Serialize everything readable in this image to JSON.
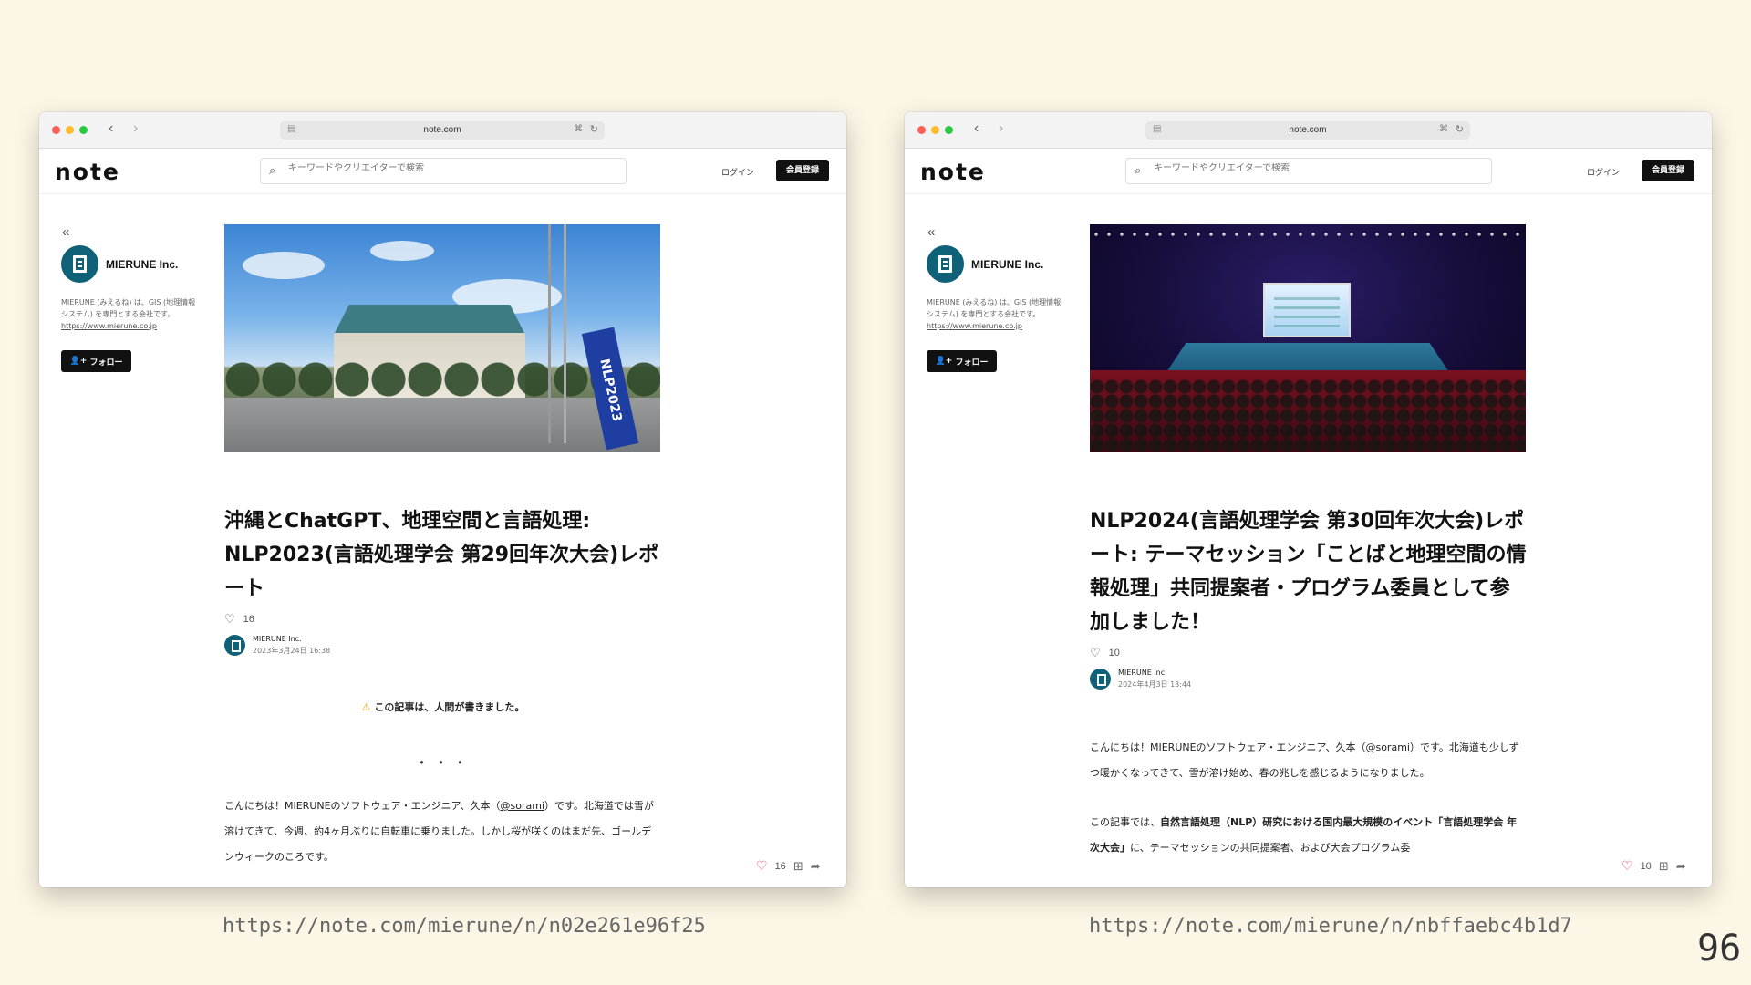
{
  "browser": {
    "url": "note.com"
  },
  "site": {
    "logo": "note",
    "search_placeholder": "キーワードやクリエイターで検索",
    "login": "ログイン",
    "signup": "会員登録"
  },
  "profile": {
    "name": "MIERUNE Inc.",
    "bio": "MIERUNE (みえるね) は、GIS (地理情報システム) を専門とする会社です。",
    "bio_link": "https://www.mierune.co.jp",
    "follow": "フォロー"
  },
  "articles": [
    {
      "title": "沖縄とChatGPT、地理空間と言語処理: NLP2023(言語処理学会 第29回年次大会)レポート",
      "likes": "16",
      "author": "MIERUNE Inc.",
      "date": "2023年3月24日 16:38",
      "banner_text": "NLP2023",
      "notice": "この記事は、人間が書きました。",
      "separator": "・・・",
      "body_pre": "こんにちは！MIERUNEのソフトウェア・エンジニア、久本（",
      "body_handle": "@sorami",
      "body_post": "）です。北海道では雪が溶けてきて、今週、約4ヶ月ぶりに自転車に乗りました。しかし桜が咲くのはまだ先、ゴールデンウィークのころです。",
      "caption_url": "https://note.com/mierune/n/n02e261e96f25"
    },
    {
      "title": "NLP2024(言語処理学会 第30回年次大会)レポート: テーマセッション「ことばと地理空間の情報処理」共同提案者・プログラム委員として参加しました！",
      "likes": "10",
      "author": "MIERUNE Inc.",
      "date": "2024年4月3日 13:44",
      "body_pre": "こんにちは！MIERUNEのソフトウェア・エンジニア、久本（",
      "body_handle": "@sorami",
      "body_post": "）です。北海道も少しずつ暖かくなってきて、雪が溶け始め、春の兆しを感じるようになりました。",
      "body2_pre": "この記事では、",
      "body2_bold": "自然言語処理（NLP）研究における国内最大規模のイベント「言語処理学会 年次大会」",
      "body2_post": "に、テーマセッションの共同提案者、および大会プログラム委",
      "caption_url": "https://note.com/mierune/n/nbffaebc4b1d7"
    }
  ],
  "page_number": "96",
  "icons": [
    "search-icon",
    "heart-icon",
    "bookmark-icon",
    "share-icon",
    "warning-icon",
    "back-arrow-icon",
    "forward-arrow-icon",
    "reload-icon",
    "translate-icon",
    "collapse-icon"
  ],
  "colors": {
    "background": "#fcf6e6",
    "brand_teal": "#0e6177",
    "button_dark": "#111111",
    "like_red": "#e0245e"
  }
}
